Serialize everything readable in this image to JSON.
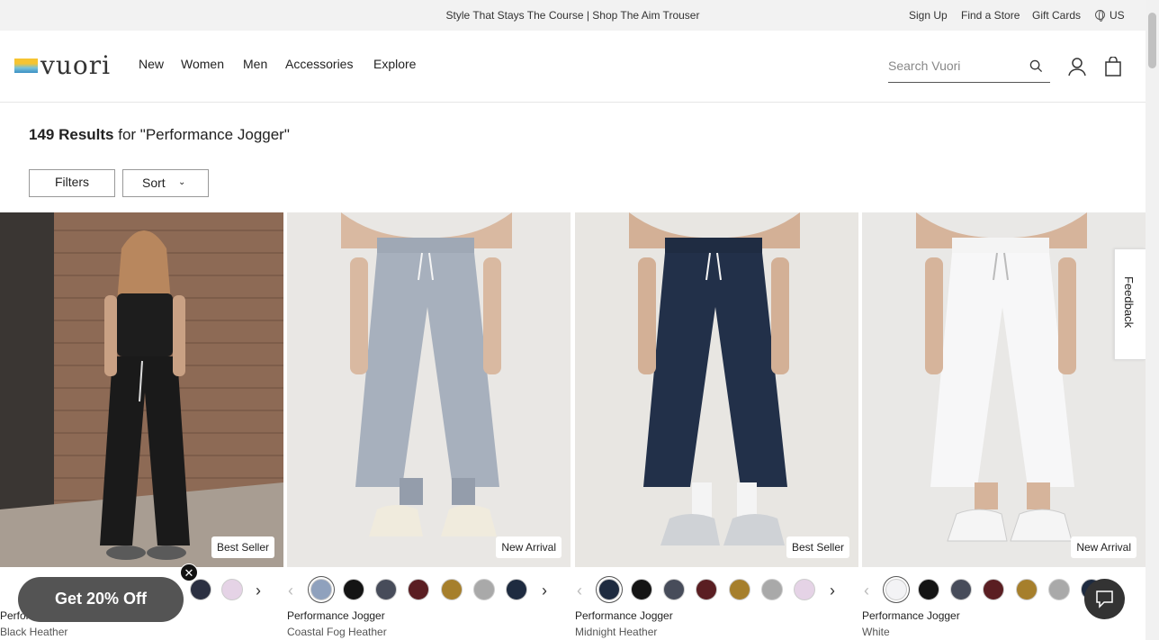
{
  "promo": {
    "text": "Style That Stays The Course | Shop The Aim Trouser",
    "links": {
      "signup": "Sign Up",
      "store": "Find a Store",
      "gift": "Gift Cards",
      "locale": "US"
    }
  },
  "header": {
    "logo_text": "vuori",
    "nav": [
      "New",
      "Women",
      "Men",
      "Accessories",
      "Explore"
    ],
    "search_placeholder": "Search Vuori"
  },
  "results": {
    "count": "149 Results",
    "query": " for \"Performance Jogger\""
  },
  "controls": {
    "filters": "Filters",
    "sort": "Sort"
  },
  "products": [
    {
      "badge": "Best Seller",
      "name": "Performance Jogger",
      "color": "Black Heather",
      "swatches": [
        "#2b3042",
        "#e5d3e6"
      ]
    },
    {
      "badge": "New Arrival",
      "name": "Performance Jogger",
      "color": "Coastal Fog Heather",
      "swatches": [
        "#8fa1bd",
        "#141414",
        "#474c5a",
        "#5a1e22",
        "#a67f2c",
        "#a9a9a9",
        "#1e2b40"
      ]
    },
    {
      "badge": "Best Seller",
      "name": "Performance Jogger",
      "color": "Midnight Heather",
      "swatches": [
        "#1e2b40",
        "#141414",
        "#474c5a",
        "#5a1e22",
        "#a67f2c",
        "#a9a9a9",
        "#e5d3e6"
      ]
    },
    {
      "badge": "New Arrival",
      "name": "Performance Jogger",
      "color": "White",
      "swatches": [
        "#f3f3f5",
        "#141414",
        "#474c5a",
        "#5a1e22",
        "#a67f2c",
        "#a9a9a9",
        "#1e2b40"
      ]
    }
  ],
  "feedback": "Feedback",
  "offer": "Get 20% Off",
  "offer_close": "✕"
}
